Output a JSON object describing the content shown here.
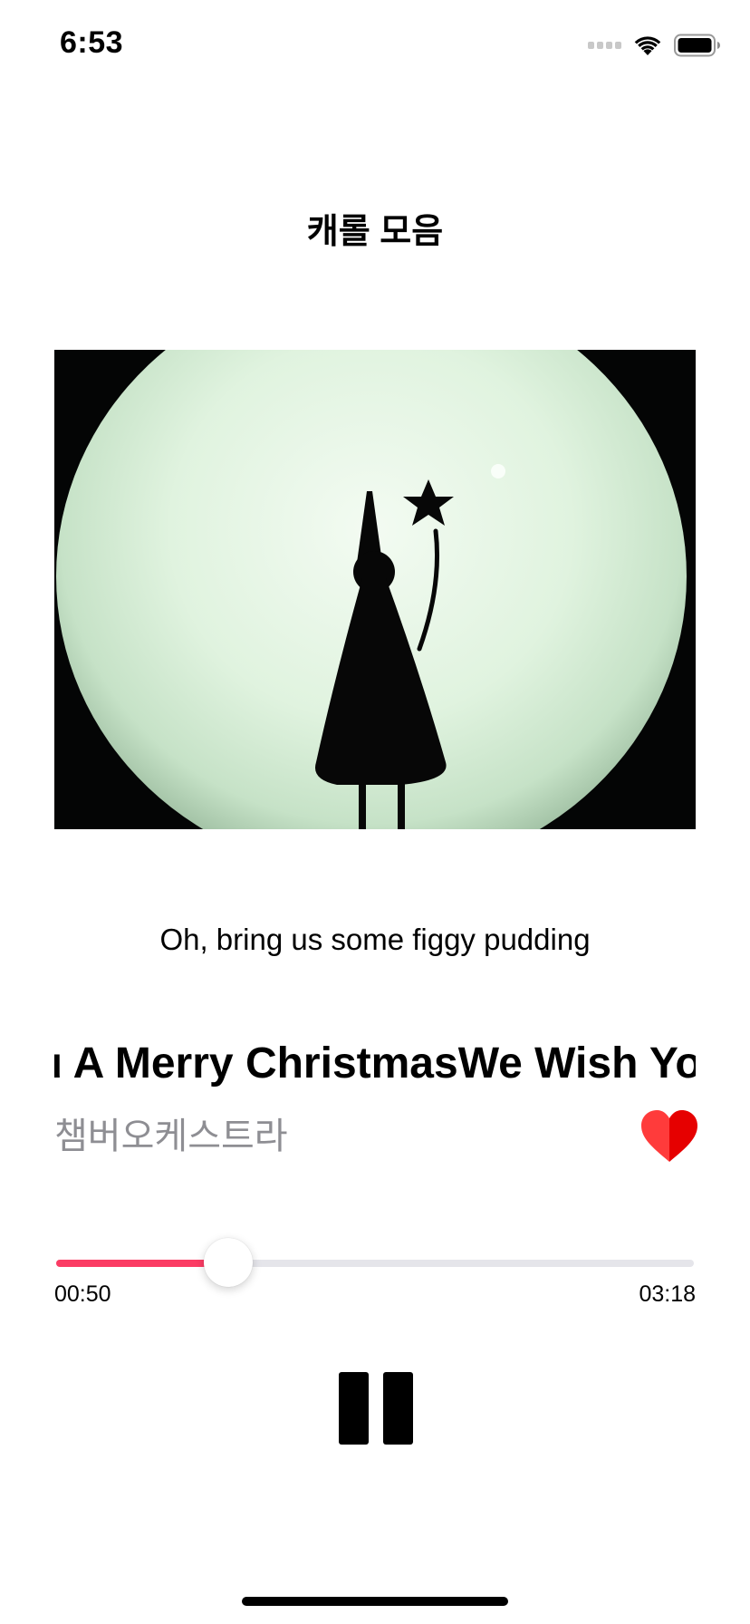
{
  "status_bar": {
    "time": "6:53",
    "icons": [
      "cellular-signal-icon",
      "wifi-icon",
      "battery-icon"
    ]
  },
  "header": {
    "title": "캐롤 모음"
  },
  "artwork": {
    "description_icon": "album-artwork"
  },
  "player": {
    "lyric": "Oh, bring us some figgy pudding",
    "song_title_marquee": "You A Merry ChristmasWe Wish You A Merry Christmas",
    "artist": "챔버오케스트라",
    "favorite_icon": "heart-icon",
    "progress": {
      "current_time": "00:50",
      "total_time": "03:18",
      "fraction": 0.27
    },
    "play_pause_icon": "pause-icon"
  },
  "colors": {
    "accent": "#fb3c64",
    "heart": "#ff2d2d",
    "secondary_text": "#8e8e93",
    "track": "#e5e5ea"
  }
}
